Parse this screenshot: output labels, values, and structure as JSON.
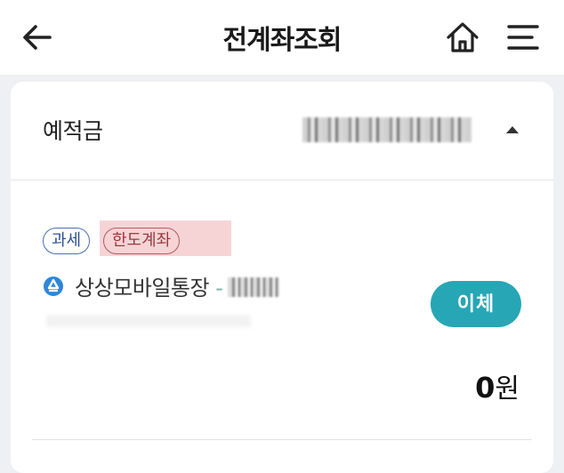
{
  "header": {
    "title": "전계좌조회",
    "back_icon": "arrow-left-icon",
    "home_icon": "home-icon",
    "menu_icon": "hamburger-menu-icon"
  },
  "deposit_section": {
    "title": "예적금",
    "collapse_icon": "triangle-up-icon"
  },
  "account": {
    "tags": [
      "과세",
      "한도계좌"
    ],
    "icon": "bank-logo-icon",
    "name": "상상모바일통장",
    "name_separator": "-",
    "transfer_label": "이체",
    "balance_value": "0",
    "balance_unit": "원"
  },
  "colors": {
    "accent": "#27a6b5",
    "tag_tax": "#4a6fb5",
    "tag_limit": "#b55a60",
    "tag_limit_highlight": "#f6d4d6",
    "bank_logo": "#2f86d8"
  }
}
